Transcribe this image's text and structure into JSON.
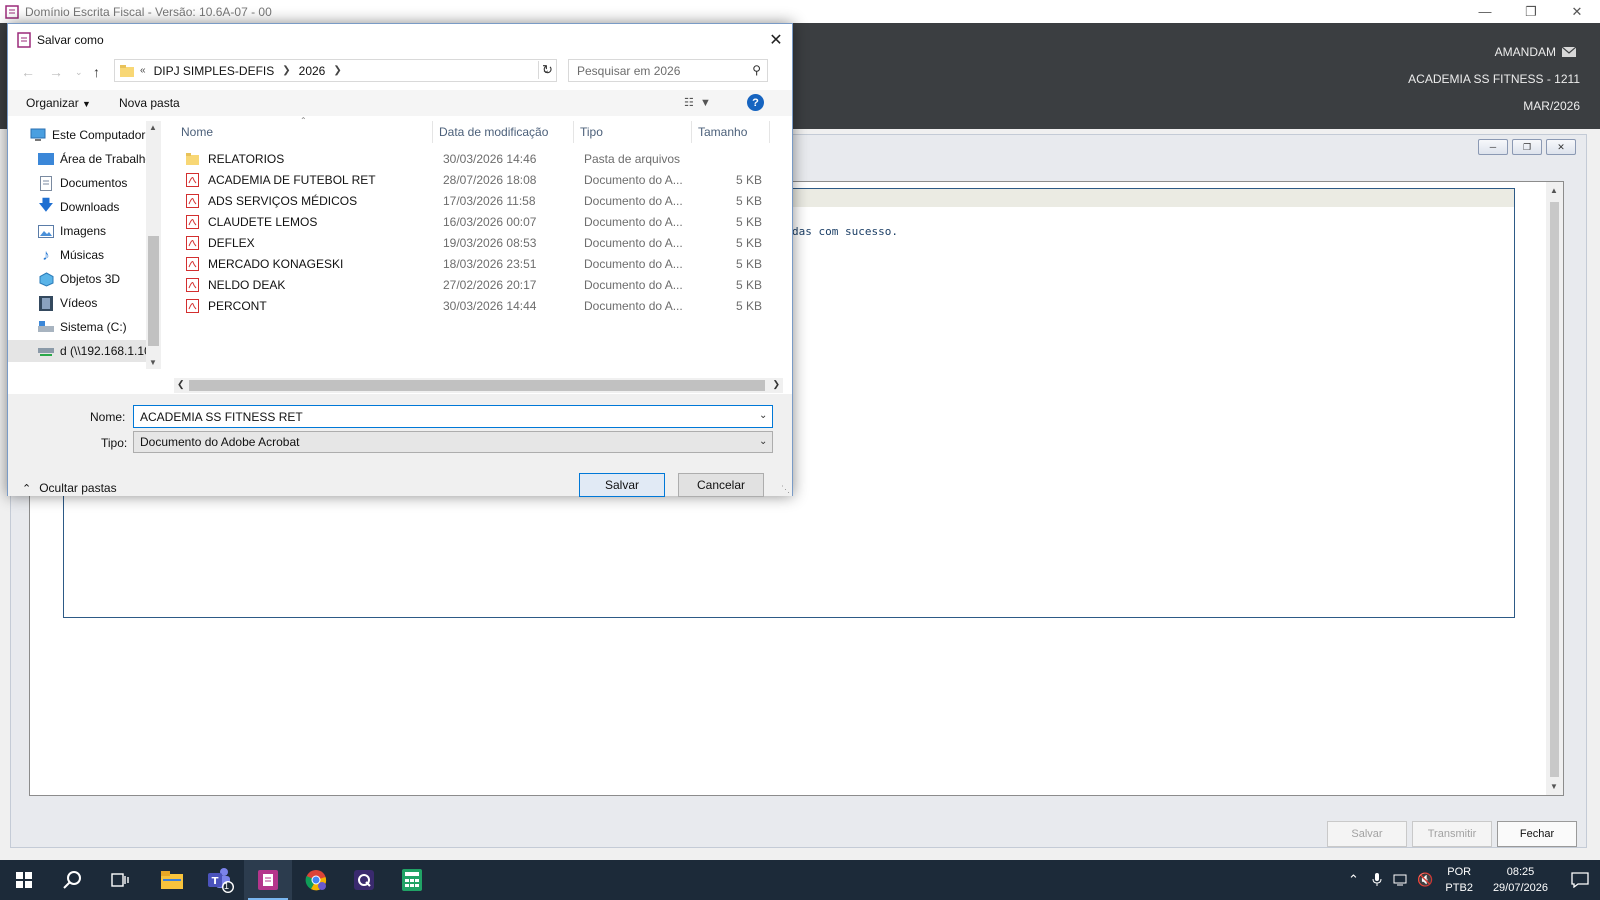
{
  "app": {
    "title": "Domínio Escrita Fiscal  - Versão: 10.6A-07 - 00",
    "user": "AMANDAM",
    "company": "ACADEMIA SS FITNESS  - 1211",
    "period": "MAR/2026",
    "log_message": "das com sucesso.",
    "buttons": {
      "salvar": "Salvar",
      "transmitir": "Transmitir",
      "fechar": "Fechar"
    }
  },
  "dialog": {
    "title": "Salvar como",
    "breadcrumb": {
      "prefix": "«",
      "items": [
        "DIPJ SIMPLES-DEFIS",
        "2026"
      ]
    },
    "search_placeholder": "Pesquisar em 2026",
    "toolbar": {
      "organizar": "Organizar",
      "nova_pasta": "Nova pasta"
    },
    "nav_items": [
      {
        "label": "Este Computador",
        "icon": "computer-icon"
      },
      {
        "label": "Área de Trabalho",
        "icon": "desktop-icon"
      },
      {
        "label": "Documentos",
        "icon": "documents-icon"
      },
      {
        "label": "Downloads",
        "icon": "download-icon"
      },
      {
        "label": "Imagens",
        "icon": "images-icon"
      },
      {
        "label": "Músicas",
        "icon": "music-icon"
      },
      {
        "label": "Objetos 3D",
        "icon": "objects3d-icon"
      },
      {
        "label": "Vídeos",
        "icon": "videos-icon"
      },
      {
        "label": "Sistema (C:)",
        "icon": "drive-icon"
      },
      {
        "label": "d (\\\\192.168.1.10",
        "icon": "network-drive-icon"
      }
    ],
    "columns": {
      "name": "Nome",
      "date": "Data de modificação",
      "type": "Tipo",
      "size": "Tamanho"
    },
    "files": [
      {
        "name": "RELATORIOS",
        "date": "30/03/2026 14:46",
        "type": "Pasta de arquivos",
        "size": "",
        "icon": "folder-icon"
      },
      {
        "name": "ACADEMIA DE FUTEBOL RET",
        "date": "28/07/2026 18:08",
        "type": "Documento do A...",
        "size": "5 KB",
        "icon": "pdf-icon"
      },
      {
        "name": "ADS SERVIÇOS MÉDICOS",
        "date": "17/03/2026 11:58",
        "type": "Documento do A...",
        "size": "5 KB",
        "icon": "pdf-icon"
      },
      {
        "name": "CLAUDETE LEMOS",
        "date": "16/03/2026 00:07",
        "type": "Documento do A...",
        "size": "5 KB",
        "icon": "pdf-icon"
      },
      {
        "name": "DEFLEX",
        "date": "19/03/2026 08:53",
        "type": "Documento do A...",
        "size": "5 KB",
        "icon": "pdf-icon"
      },
      {
        "name": "MERCADO KONAGESKI",
        "date": "18/03/2026 23:51",
        "type": "Documento do A...",
        "size": "5 KB",
        "icon": "pdf-icon"
      },
      {
        "name": "NELDO DEAK",
        "date": "27/02/2026 20:17",
        "type": "Documento do A...",
        "size": "5 KB",
        "icon": "pdf-icon"
      },
      {
        "name": "PERCONT",
        "date": "30/03/2026 14:44",
        "type": "Documento do A...",
        "size": "5 KB",
        "icon": "pdf-icon"
      }
    ],
    "nome_label": "Nome:",
    "nome_value": "ACADEMIA SS FITNESS RET",
    "tipo_label": "Tipo:",
    "tipo_value": "Documento do Adobe Acrobat",
    "ocultar_pastas": "Ocultar pastas",
    "salvar": "Salvar",
    "cancelar": "Cancelar"
  },
  "taskbar": {
    "lang_top": "POR",
    "lang_bottom": "PTB2",
    "time": "08:25",
    "date": "29/07/2026",
    "teams_badge": "1"
  },
  "colors": {
    "accent": "#0078d7",
    "header": "#3b3e41",
    "taskbar": "#1c2a39",
    "pdf": "#d32f2f",
    "folder": "#f8d775"
  }
}
